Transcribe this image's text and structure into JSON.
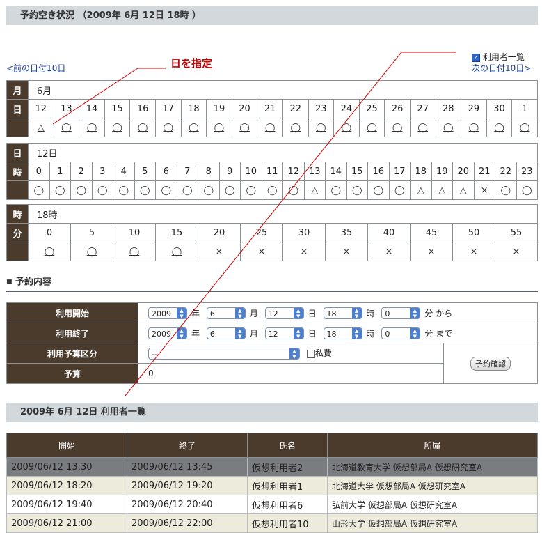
{
  "page_title": "予約空き状況  （2009年 6月 12日 18時 ）",
  "annotation": "日を指定",
  "nav": {
    "prev": "<前の日付10日",
    "next": "次の日付10日>",
    "user_list_label": "利用者一覧"
  },
  "day_table": {
    "row_month_label": "月",
    "month_value": "6月",
    "row_day_label": "日",
    "days": [
      "12",
      "13",
      "14",
      "15",
      "16",
      "17",
      "18",
      "19",
      "20",
      "21",
      "22",
      "23",
      "24",
      "25",
      "26",
      "27",
      "28",
      "29",
      "30",
      "1"
    ],
    "marks": [
      "△",
      "◯",
      "◯",
      "◯",
      "◯",
      "◯",
      "◯",
      "◯",
      "◯",
      "◯",
      "◯",
      "◯",
      "◯",
      "◯",
      "◯",
      "◯",
      "◯",
      "◯",
      "◯",
      "◯"
    ]
  },
  "hour_table": {
    "row_day_label": "日",
    "day_value": "12日",
    "row_hour_label": "時",
    "hours": [
      "0",
      "1",
      "2",
      "3",
      "4",
      "5",
      "6",
      "7",
      "8",
      "9",
      "10",
      "11",
      "12",
      "13",
      "14",
      "15",
      "16",
      "17",
      "18",
      "19",
      "20",
      "21",
      "22",
      "23"
    ],
    "marks": [
      "◯",
      "◯",
      "◯",
      "◯",
      "◯",
      "◯",
      "◯",
      "◯",
      "◯",
      "◯",
      "◯",
      "◯",
      "◯",
      "△",
      "◯",
      "◯",
      "◯",
      "◯",
      "△",
      "△",
      "△",
      "×",
      "◯",
      "◯"
    ]
  },
  "minute_table": {
    "row_hour_label": "時",
    "hour_value": "18時",
    "row_minute_label": "分",
    "minutes": [
      "0",
      "5",
      "10",
      "15",
      "20",
      "25",
      "30",
      "35",
      "40",
      "45",
      "50",
      "55"
    ],
    "marks": [
      "◯",
      "◯",
      "◯",
      "◯",
      "×",
      "×",
      "×",
      "×",
      "×",
      "×",
      "×",
      "×"
    ]
  },
  "section_title": "予約内容",
  "form": {
    "start_label": "利用開始",
    "end_label": "利用終了",
    "budget_type_label": "利用予算区分",
    "budget_label": "予算",
    "year_value": "2009",
    "month_value": "6",
    "day_value": "12",
    "hour_value": "18",
    "minute_value": "0",
    "unit_year": "年",
    "unit_month": "月",
    "unit_day": "日",
    "unit_hour": "時",
    "unit_min_from": "分 から",
    "unit_min_to": "分 まで",
    "budget_type_value": "---",
    "private_label": "私費",
    "budget_value": "0",
    "confirm_button": "予約確認"
  },
  "users_title": "2009年 6月 12日 利用者一覧",
  "users_table": {
    "headers": [
      "開始",
      "終了",
      "氏名",
      "所属"
    ],
    "rows": [
      [
        "2009/06/12 13:30",
        "2009/06/12 13:45",
        "仮想利用者2",
        "北海道教育大学 仮想部局A 仮想研究室A"
      ],
      [
        "2009/06/12 18:20",
        "2009/06/12 19:20",
        "仮想利用者1",
        "北海道大学 仮想部局A 仮想研究室A"
      ],
      [
        "2009/06/12 19:40",
        "2009/06/12 20:40",
        "仮想利用者6",
        "弘前大学 仮想部局A 仮想研究室A"
      ],
      [
        "2009/06/12 21:00",
        "2009/06/12 22:00",
        "仮想利用者10",
        "山形大学 仮想部局A 仮想研究室A"
      ]
    ]
  }
}
